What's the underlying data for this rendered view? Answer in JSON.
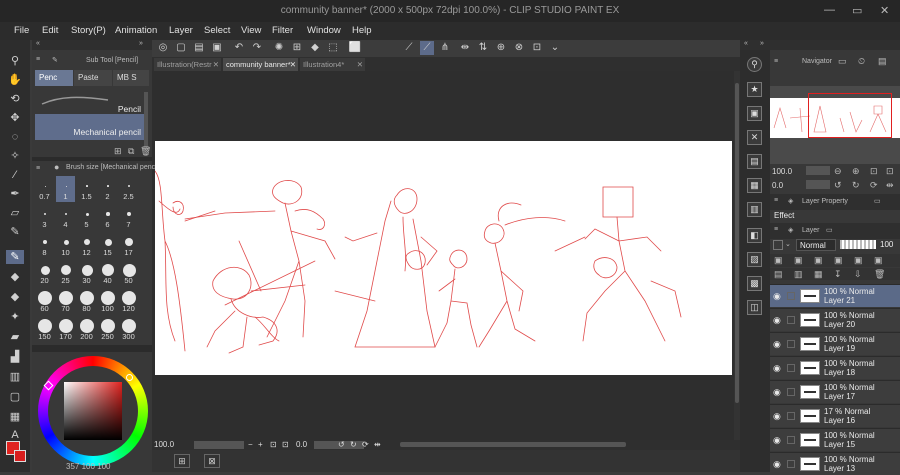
{
  "window": {
    "title": "community banner* (2000 x 500px 72dpi 100.0%) - CLIP STUDIO PAINT EX"
  },
  "menu": [
    "File",
    "Edit",
    "Story(P)",
    "Animation",
    "Layer",
    "Select",
    "View",
    "Filter",
    "Window",
    "Help"
  ],
  "tabs": [
    {
      "label": "Illustration(Restr",
      "active": false
    },
    {
      "label": "community banner*",
      "active": true
    },
    {
      "label": "Illustration4*",
      "active": false
    }
  ],
  "subtool": {
    "header": "Sub Tool [Pencil]",
    "tabs": [
      "Penc",
      "Paste",
      "MB S"
    ],
    "brushes": [
      "Pencil",
      "Mechanical pencil"
    ],
    "selected_brush": "Mechanical pencil"
  },
  "brush_size": {
    "header": "Brush size [Mechanical penc",
    "sizes": [
      "0.7",
      "1",
      "1.5",
      "2",
      "2.5",
      "3",
      "4",
      "5",
      "6",
      "7",
      "8",
      "10",
      "12",
      "15",
      "17",
      "20",
      "25",
      "30",
      "40",
      "50",
      "60",
      "70",
      "80",
      "100",
      "120",
      "150",
      "170",
      "200",
      "250",
      "300"
    ],
    "selected": "1"
  },
  "color": {
    "main": "#e0231f",
    "sub": "#d81e1e",
    "readout": "357 100 100"
  },
  "status": {
    "zoom": "100.0",
    "angle": "0.0"
  },
  "navigator": {
    "label": "Navigator",
    "zoom": "100.0",
    "angle": "0.0"
  },
  "layer_property": {
    "label": "Layer Property",
    "effect": "Effect"
  },
  "layers_panel": {
    "label": "Layer",
    "blend_mode": "Normal",
    "opacity": "100",
    "layers": [
      {
        "pct": "100 % Normal",
        "name": "Layer 21",
        "selected": true
      },
      {
        "pct": "100 % Normal",
        "name": "Layer 20",
        "selected": false
      },
      {
        "pct": "100 % Normal",
        "name": "Layer 19",
        "selected": false
      },
      {
        "pct": "100 % Normal",
        "name": "Layer 18",
        "selected": false
      },
      {
        "pct": "100 % Normal",
        "name": "Layer 17",
        "selected": false
      },
      {
        "pct": "17 % Normal",
        "name": "Layer 16",
        "selected": false
      },
      {
        "pct": "100 % Normal",
        "name": "Layer 15",
        "selected": false
      },
      {
        "pct": "100 % Normal",
        "name": "Layer 13",
        "selected": false
      }
    ]
  },
  "icons": {
    "tools": [
      "magnifier-icon",
      "hand-icon",
      "rotate-icon",
      "move-icon",
      "lasso-icon",
      "wand-icon",
      "eyedropper-icon",
      "pen-icon",
      "pencil-icon",
      "brush-icon",
      "airbrush-icon",
      "eraser-icon",
      "blend-icon",
      "fill-icon",
      "gradient-icon",
      "figure-icon",
      "frame-icon",
      "text-icon"
    ]
  }
}
